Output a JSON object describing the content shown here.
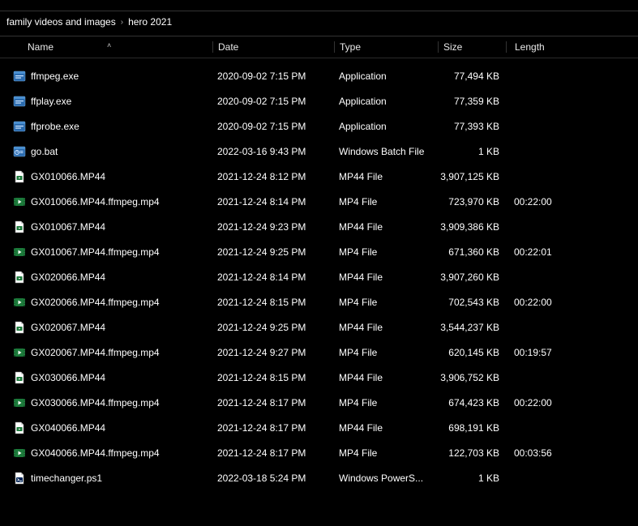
{
  "breadcrumb": {
    "items": [
      "family videos and images",
      "hero 2021"
    ],
    "sep": "›"
  },
  "columns": {
    "name": "Name",
    "date": "Date",
    "type": "Type",
    "size": "Size",
    "length": "Length",
    "sort_indicator": "˄"
  },
  "icons": {
    "exe": "exe",
    "bat": "bat",
    "mp44": "mp44",
    "mp4": "mp4",
    "ps1": "ps1"
  },
  "files": [
    {
      "icon": "exe",
      "name": "ffmpeg.exe",
      "date": "2020-09-02 7:15 PM",
      "type": "Application",
      "size": "77,494 KB",
      "length": ""
    },
    {
      "icon": "exe",
      "name": "ffplay.exe",
      "date": "2020-09-02 7:15 PM",
      "type": "Application",
      "size": "77,359 KB",
      "length": ""
    },
    {
      "icon": "exe",
      "name": "ffprobe.exe",
      "date": "2020-09-02 7:15 PM",
      "type": "Application",
      "size": "77,393 KB",
      "length": ""
    },
    {
      "icon": "bat",
      "name": "go.bat",
      "date": "2022-03-16 9:43 PM",
      "type": "Windows Batch File",
      "size": "1 KB",
      "length": ""
    },
    {
      "icon": "mp44",
      "name": "GX010066.MP44",
      "date": "2021-12-24 8:12 PM",
      "type": "MP44 File",
      "size": "3,907,125 KB",
      "length": ""
    },
    {
      "icon": "mp4",
      "name": "GX010066.MP44.ffmpeg.mp4",
      "date": "2021-12-24 8:14 PM",
      "type": "MP4 File",
      "size": "723,970 KB",
      "length": "00:22:00"
    },
    {
      "icon": "mp44",
      "name": "GX010067.MP44",
      "date": "2021-12-24 9:23 PM",
      "type": "MP44 File",
      "size": "3,909,386 KB",
      "length": ""
    },
    {
      "icon": "mp4",
      "name": "GX010067.MP44.ffmpeg.mp4",
      "date": "2021-12-24 9:25 PM",
      "type": "MP4 File",
      "size": "671,360 KB",
      "length": "00:22:01"
    },
    {
      "icon": "mp44",
      "name": "GX020066.MP44",
      "date": "2021-12-24 8:14 PM",
      "type": "MP44 File",
      "size": "3,907,260 KB",
      "length": ""
    },
    {
      "icon": "mp4",
      "name": "GX020066.MP44.ffmpeg.mp4",
      "date": "2021-12-24 8:15 PM",
      "type": "MP4 File",
      "size": "702,543 KB",
      "length": "00:22:00"
    },
    {
      "icon": "mp44",
      "name": "GX020067.MP44",
      "date": "2021-12-24 9:25 PM",
      "type": "MP44 File",
      "size": "3,544,237 KB",
      "length": ""
    },
    {
      "icon": "mp4",
      "name": "GX020067.MP44.ffmpeg.mp4",
      "date": "2021-12-24 9:27 PM",
      "type": "MP4 File",
      "size": "620,145 KB",
      "length": "00:19:57"
    },
    {
      "icon": "mp44",
      "name": "GX030066.MP44",
      "date": "2021-12-24 8:15 PM",
      "type": "MP44 File",
      "size": "3,906,752 KB",
      "length": ""
    },
    {
      "icon": "mp4",
      "name": "GX030066.MP44.ffmpeg.mp4",
      "date": "2021-12-24 8:17 PM",
      "type": "MP4 File",
      "size": "674,423 KB",
      "length": "00:22:00"
    },
    {
      "icon": "mp44",
      "name": "GX040066.MP44",
      "date": "2021-12-24 8:17 PM",
      "type": "MP44 File",
      "size": "698,191 KB",
      "length": ""
    },
    {
      "icon": "mp4",
      "name": "GX040066.MP44.ffmpeg.mp4",
      "date": "2021-12-24 8:17 PM",
      "type": "MP4 File",
      "size": "122,703 KB",
      "length": "00:03:56"
    },
    {
      "icon": "ps1",
      "name": "timechanger.ps1",
      "date": "2022-03-18 5:24 PM",
      "type": "Windows PowerS...",
      "size": "1 KB",
      "length": ""
    }
  ]
}
